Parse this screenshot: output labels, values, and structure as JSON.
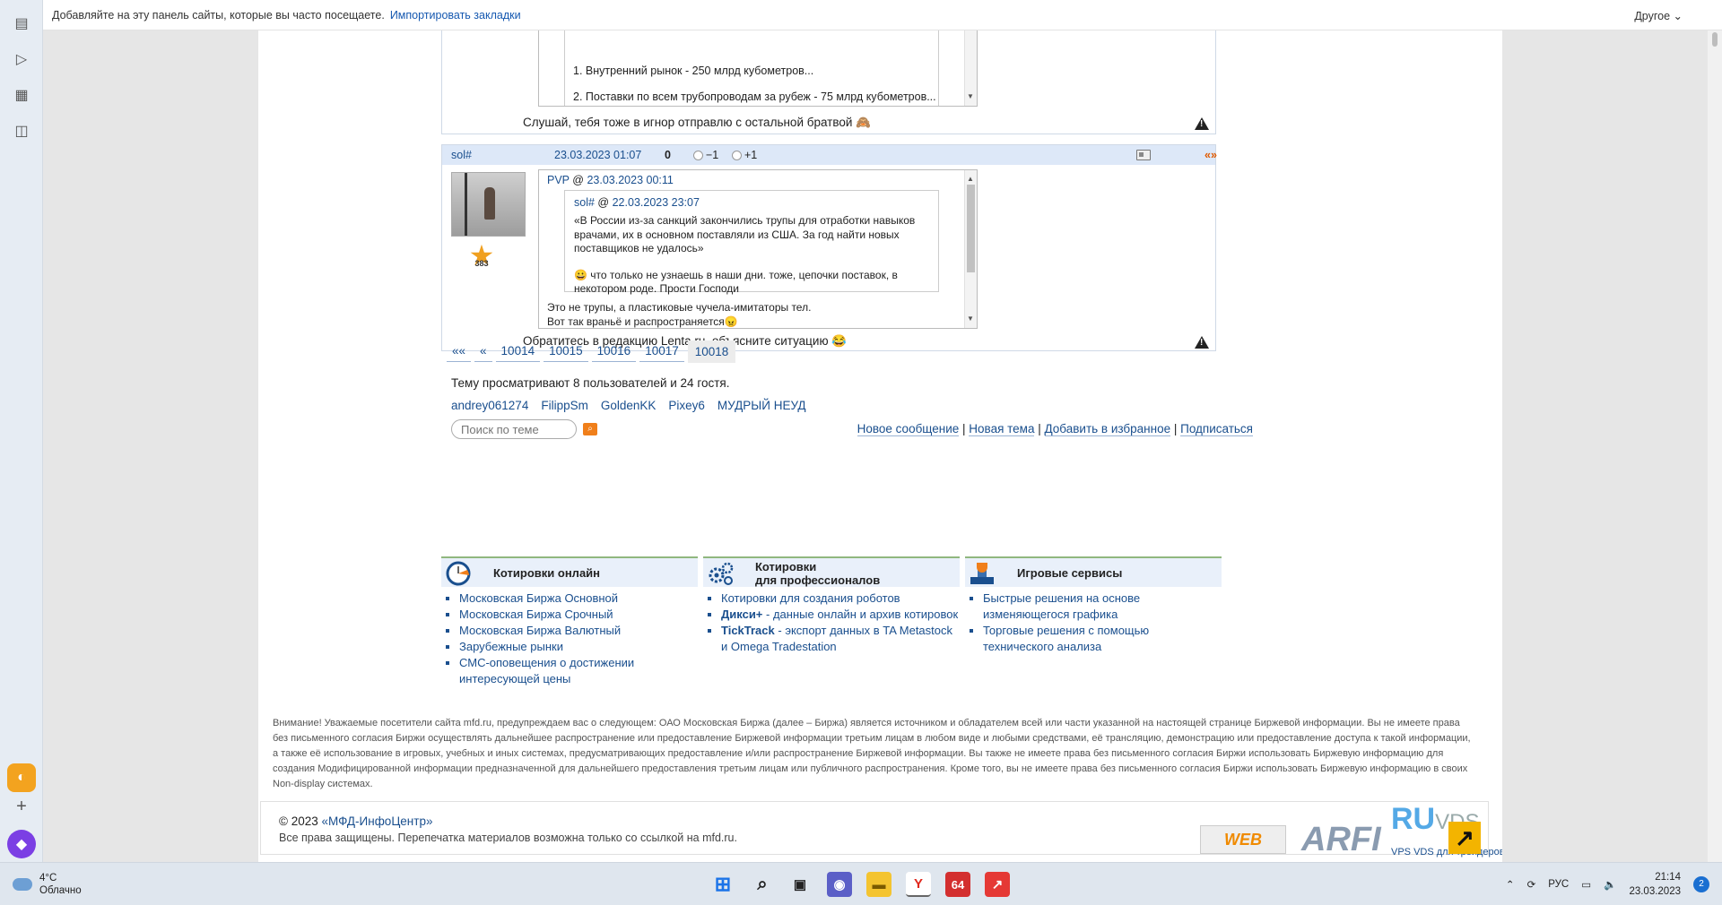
{
  "bookmarks_bar": {
    "hint": "Добавляйте на эту панель сайты, которые вы часто посещаете.",
    "import_link": "Импортировать закладки",
    "other": "Другое"
  },
  "post1": {
    "quote_lines": [
      "1. Внутренний рынок - 250 млрд кубометров...",
      "2. Поставки по всем трубопроводам за рубеж - 75 млрд кубометров..."
    ],
    "signature": "Слушай, тебя тоже в игнор отправлю с остальной братвой 🙈"
  },
  "post2": {
    "author": "sol#",
    "date": "23.03.2023 01:07",
    "score": "0",
    "vote_minus": "−1",
    "vote_plus": "+1",
    "quote_marker": "«»",
    "star_count": "383",
    "outer_quote_author": "PVP",
    "outer_quote_at": "@",
    "outer_quote_date": "23.03.2023 00:11",
    "inner_quote_author": "sol#",
    "inner_quote_at": "@",
    "inner_quote_date": "22.03.2023 23:07",
    "inner_quote_text": "«В России из-за санкций закончились трупы для отработки навыков врачами, их в основном поставляли из США. За год найти новых поставщиков не удалось»",
    "inner_quote_reply": "😀 что только не узнаешь в наши дни. тоже, цепочки поставок, в некотором роде. Прости Господи",
    "reply_line1": "Это не трупы, а пластиковые чучела-имитаторы тел.",
    "reply_line2": "Вот так враньё и распространяется😠",
    "signature": "Обратитесь в редакцию Lenta.ru, объясните ситуацию 😂"
  },
  "pagination": {
    "first": "««",
    "prev": "«",
    "pages": [
      "10014",
      "10015",
      "10016",
      "10017"
    ],
    "current": "10018"
  },
  "viewers_text": "Тему просматривают 8 пользователей и 24 гостя.",
  "viewers": [
    "andrey061274",
    "FilippSm",
    "GoldenKK",
    "Pixey6",
    "МУДРЫЙ НЕУД"
  ],
  "search": {
    "placeholder": "Поиск по теме"
  },
  "actions": [
    "Новое сообщение",
    "Новая тема",
    "Добавить в избранное",
    "Подписаться"
  ],
  "services": [
    {
      "title": "Котировки онлайн",
      "items": [
        "Московская Биржа Основной",
        "Московская Биржа Срочный",
        "Московская Биржа Валютный",
        "Зарубежные рынки",
        "СМС-оповещения о достижении интересующей цены"
      ]
    },
    {
      "title_line1": "Котировки",
      "title_line2": "для профессионалов",
      "items": [
        {
          "bold": "",
          "text": "Котировки для создания роботов"
        },
        {
          "bold": "Дикси+",
          "text": " - данные онлайн и архив котировок"
        },
        {
          "bold": "TickTrack",
          "text": " - экспорт данных в TA Metastock и Omega Tradestation"
        }
      ]
    },
    {
      "title": "Игровые сервисы",
      "items": [
        "Быстрые решения на основе изменяющегося графика",
        "Торговые решения с помощью технического анализа"
      ]
    }
  ],
  "disclaimer": "Внимание! Уважаемые посетители сайта mfd.ru, предупреждаем вас о следующем: ОАО Московская Биржа (далее – Биржа) является источником и обладателем всей или части указанной на настоящей странице Биржевой информации. Вы не имеете права без письменного согласия Биржи осуществлять дальнейшее распространение или предоставление Биржевой информации третьим лицам в любом виде и любыми средствами, её трансляцию, демонстрацию или предоставление доступа к такой информации, а также её использование в игровых, учебных и иных системах, предусматривающих предоставление и/или распространение Биржевой информации. Вы также не имеете права без письменного согласия Биржи использовать Биржевую информацию для создания Модифицированной информации предназначенной для дальнейшего предоставления третьим лицам или публичного распространения. Кроме того, вы не имеете права без письменного согласия Биржи использовать Биржевую информацию в своих Non-display системах.",
  "footer": {
    "copyright_prefix": "© 2023 ",
    "copyright_link": "«МФД-ИнфоЦентр»",
    "rights": "Все права защищены. Перепечатка материалов возможна только со ссылкой на mfd.ru.",
    "logo_3web": "WEB",
    "logo_arfi": "ARFI",
    "logo_ru": "RU",
    "logo_vds": "VDS",
    "ruvds_tag_link": "VPS VDS",
    "ruvds_tag_text": " для трейдеров"
  },
  "taskbar": {
    "temp": "4°C",
    "weather": "Облачно",
    "lang": "РУС",
    "time": "21:14",
    "date": "23.03.2023",
    "notifications": "2",
    "app_64": "64"
  }
}
